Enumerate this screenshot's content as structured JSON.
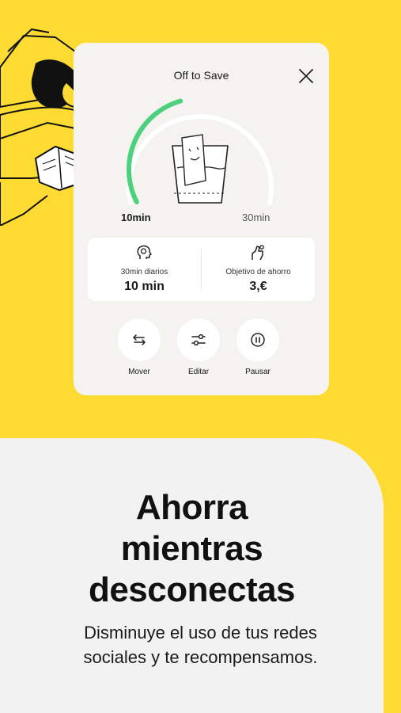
{
  "card": {
    "title": "Off to Save",
    "gauge": {
      "left_label": "10min",
      "right_label": "30min",
      "progress_fraction": 0.33
    },
    "stats": [
      {
        "icon": "head-profile-icon",
        "label": "30min diarios",
        "value": "10 min"
      },
      {
        "icon": "hand-coin-icon",
        "label": "Objetivo de ahorro",
        "value": "3,€"
      }
    ],
    "actions": [
      {
        "icon": "swap-arrows-icon",
        "label": "Mover"
      },
      {
        "icon": "sliders-icon",
        "label": "Editar"
      },
      {
        "icon": "pause-icon",
        "label": "Pausar"
      }
    ]
  },
  "headline": {
    "line1": "Ahorra",
    "line2": "mientras",
    "line3": "desconectas"
  },
  "subtitle": {
    "line1": "Disminuye el uso de tus redes",
    "line2": "sociales y te recompensamos."
  },
  "colors": {
    "background": "#FDDB33",
    "accent": "#4ED17E",
    "card": "#F4F3EF",
    "panel": "#F2F2F2"
  }
}
